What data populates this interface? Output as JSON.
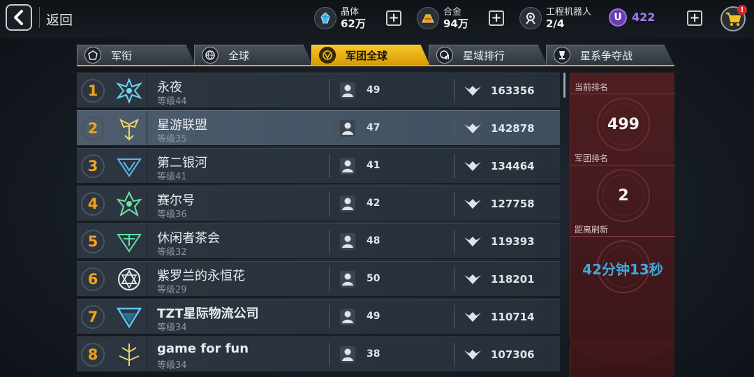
{
  "topbar": {
    "back_label": "返回",
    "resources": [
      {
        "label": "晶体",
        "value": "62万",
        "icon": "crystal-icon"
      },
      {
        "label": "合金",
        "value": "94万",
        "icon": "alloy-icon"
      },
      {
        "label": "工程机器人",
        "value": "2/4",
        "icon": "robot-icon"
      }
    ],
    "u_badge": "U",
    "u_value": "422",
    "plus": "+",
    "cart_badge": "!"
  },
  "tabs": [
    {
      "label": "军衔",
      "icon": "rank-emblem-icon",
      "active": false
    },
    {
      "label": "全球",
      "icon": "globe-icon",
      "active": false
    },
    {
      "label": "军团全球",
      "icon": "legion-globe-icon",
      "active": true
    },
    {
      "label": "星域排行",
      "icon": "star-region-icon",
      "active": false
    },
    {
      "label": "星系争夺战",
      "icon": "trophy-icon",
      "active": false
    }
  ],
  "rows": [
    {
      "rank": "1",
      "name": "永夜",
      "level": "等级44",
      "members": "49",
      "power": "163356"
    },
    {
      "rank": "2",
      "name": "星游联盟",
      "level": "等级35",
      "members": "47",
      "power": "142878"
    },
    {
      "rank": "3",
      "name": "第二银河",
      "level": "等级41",
      "members": "41",
      "power": "134464"
    },
    {
      "rank": "4",
      "name": "赛尔号",
      "level": "等级36",
      "members": "42",
      "power": "127758"
    },
    {
      "rank": "5",
      "name": "休闲者茶会",
      "level": "等级32",
      "members": "48",
      "power": "119393"
    },
    {
      "rank": "6",
      "name": "紫罗兰的永恒花",
      "level": "等级29",
      "members": "50",
      "power": "118201"
    },
    {
      "rank": "7",
      "name": "TZT星际物流公司",
      "level": "等级34",
      "members": "49",
      "power": "110714"
    },
    {
      "rank": "8",
      "name": "game for fun",
      "level": "等级34",
      "members": "38",
      "power": "107306"
    }
  ],
  "panel": {
    "current_rank_label": "当前排名",
    "current_rank": "499",
    "legion_rank_label": "军团排名",
    "legion_rank": "2",
    "refresh_label": "距离刷新",
    "refresh_time": "42分钟13秒"
  },
  "colors": {
    "accent": "#f0a21b",
    "tab_active": "#f6c62a",
    "timer": "#3fa9d8",
    "panel": "#4d1e22",
    "currency": "#a57cf0"
  }
}
